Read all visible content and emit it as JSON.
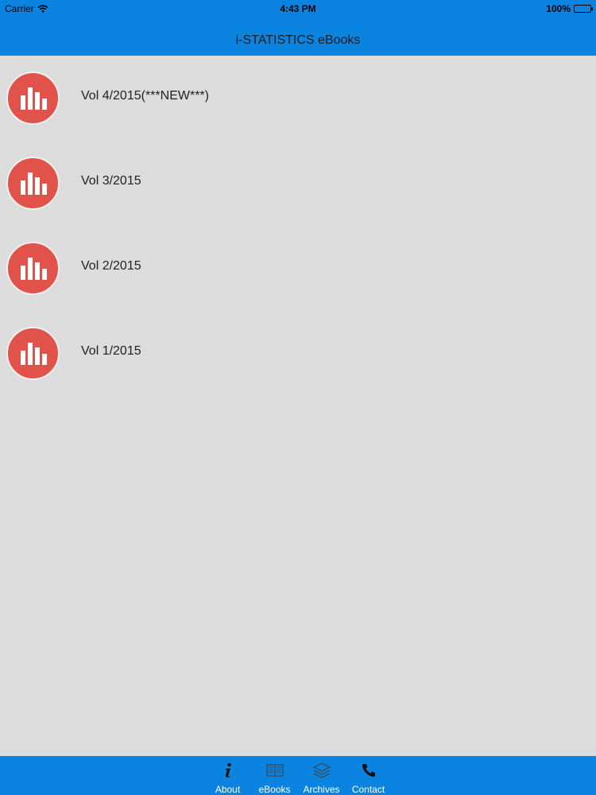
{
  "status_bar": {
    "carrier": "Carrier",
    "time": "4:43 PM",
    "battery": "100%"
  },
  "header": {
    "title": "i-STATISTICS eBooks"
  },
  "list": {
    "items": [
      {
        "label": "Vol 4/2015(***NEW***)",
        "icon": "bar-chart-icon"
      },
      {
        "label": "Vol 3/2015",
        "icon": "bar-chart-icon"
      },
      {
        "label": "Vol 2/2015",
        "icon": "bar-chart-icon"
      },
      {
        "label": "Vol 1/2015",
        "icon": "bar-chart-icon"
      }
    ]
  },
  "tabbar": {
    "tabs": [
      {
        "label": "About",
        "icon": "info-icon"
      },
      {
        "label": "eBooks",
        "icon": "book-icon"
      },
      {
        "label": "Archives",
        "icon": "layers-icon"
      },
      {
        "label": "Contact",
        "icon": "phone-icon"
      }
    ]
  },
  "colors": {
    "accent": "#0a84e0",
    "icon_bg": "#e0524a",
    "background": "#dcdcdc"
  }
}
